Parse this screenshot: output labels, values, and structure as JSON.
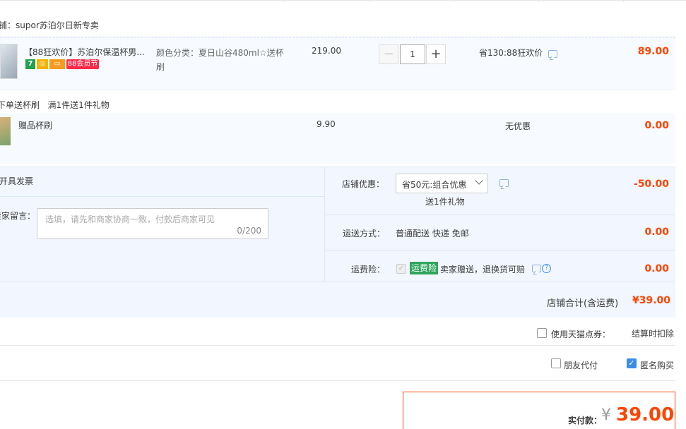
{
  "shop": {
    "label": "铺：supor苏泊尔日新专卖"
  },
  "item": {
    "title": "【88狂欢价】苏泊尔保温杯男...",
    "badges": [
      "7",
      "◎",
      "▭",
      "88会员节"
    ],
    "sku": "颜色分类：夏日山谷480ml☆送杯刷",
    "unit_price": "219.00",
    "qty_minus": "−",
    "qty_value": "1",
    "qty_plus": "+",
    "promo": "省130:88狂欢价",
    "subtotal": "89.00"
  },
  "gift_header": {
    "line1": "下单送杯刷",
    "line2": "满1件送1件礼物"
  },
  "gift": {
    "title": "赠品杯刷",
    "price": "9.90",
    "promo": "无优惠",
    "subtotal": "0.00"
  },
  "invoice": {
    "label": "开具发票"
  },
  "message": {
    "label": "卖家留言：",
    "placeholder": "选填，请先和商家协商一致，付款后商家可见",
    "counter": "0/200"
  },
  "discount": {
    "label": "店铺优惠：",
    "selected": "省50元:组合优惠",
    "note": "送1件礼物",
    "value": "-50.00"
  },
  "shipping": {
    "label": "运送方式：",
    "value_text": "普通配送 快递 免邮",
    "amount": "0.00"
  },
  "insurance": {
    "label": "运费险：",
    "tag": "运费险",
    "desc": "卖家赠送，退换货可赔",
    "help": "?",
    "amount": "0.00"
  },
  "shop_total": {
    "label": "店铺合计(含运费)",
    "value": "¥39.00"
  },
  "coupon": {
    "label": "使用天猫点券：",
    "note": "结算时扣除"
  },
  "friend_pay": {
    "label": "朋友代付"
  },
  "anonymous": {
    "label": "匿名购买",
    "checked": true
  },
  "final": {
    "label": "实付款：",
    "currency": "¥",
    "amount": "39.00"
  },
  "colors": {
    "accent_red": "#ff4400",
    "border_blue": "#b2d1ff",
    "bg_blue": "#f2f7ff",
    "checkbox_blue": "#3a8ee6",
    "insurance_green": "#2fa55c"
  }
}
